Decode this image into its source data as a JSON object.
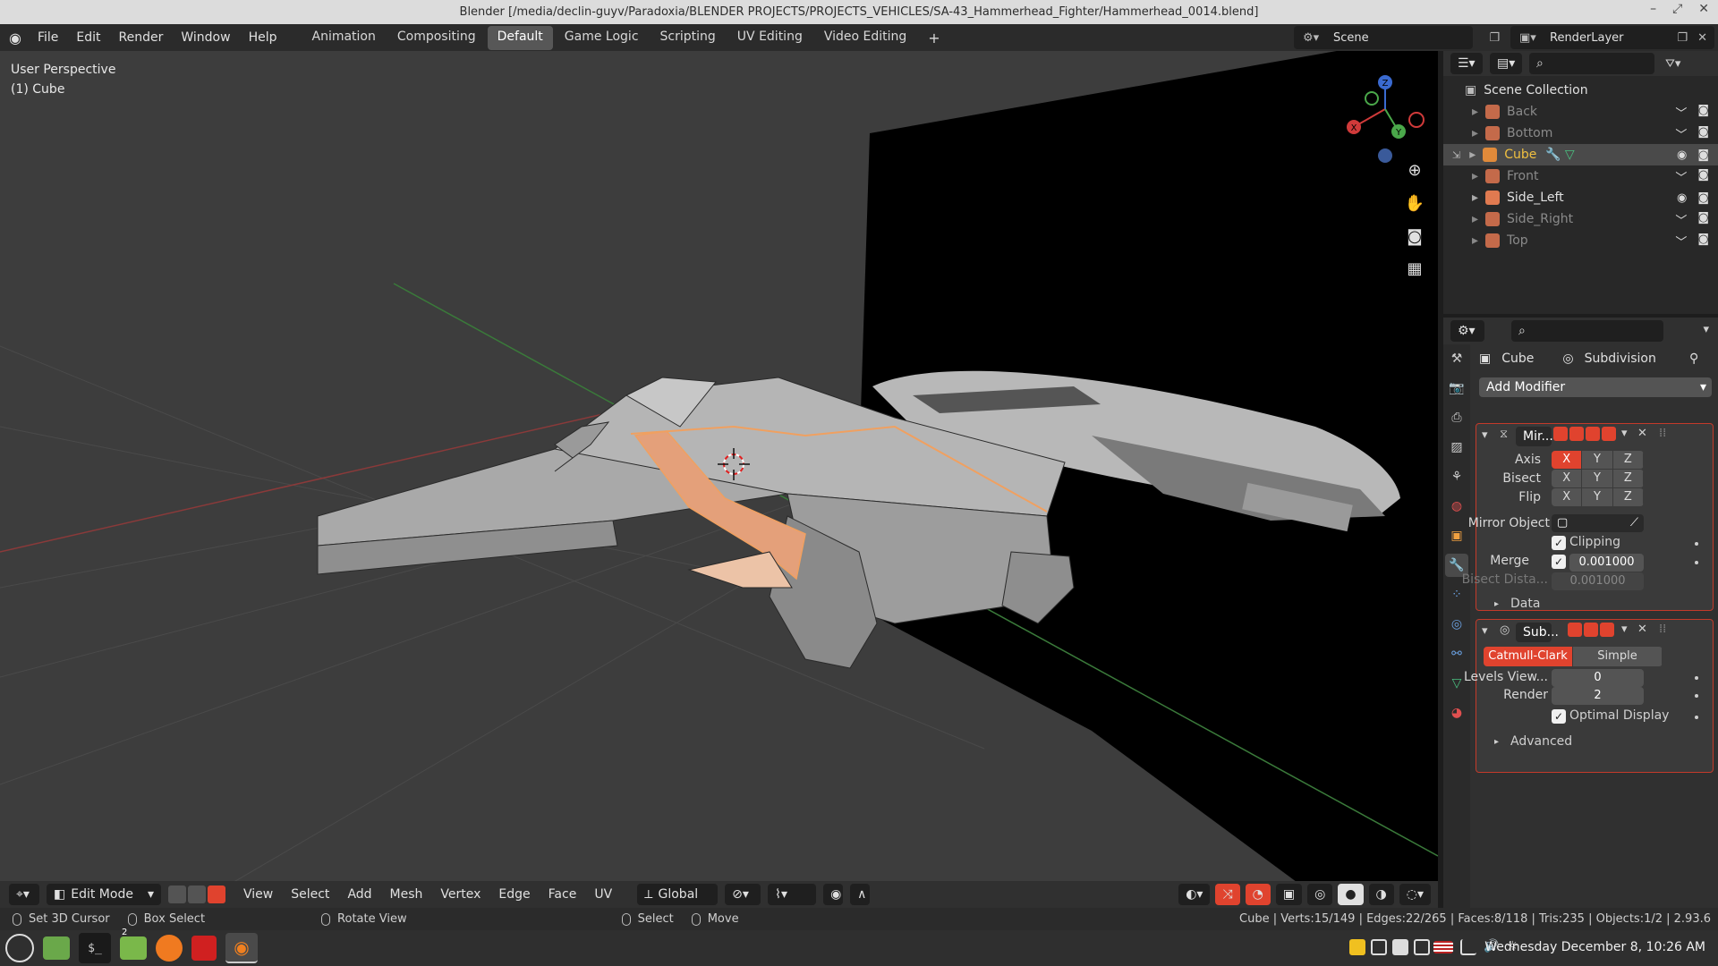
{
  "window": {
    "title": "Blender [/media/declin-guyv/Paradoxia/BLENDER PROJECTS/PROJECTS_VEHICLES/SA-43_Hammerhead_Fighter/Hammerhead_0014.blend]"
  },
  "menus": [
    "File",
    "Edit",
    "Render",
    "Window",
    "Help"
  ],
  "workspaces": [
    {
      "label": "Animation",
      "active": false
    },
    {
      "label": "Compositing",
      "active": false
    },
    {
      "label": "Default",
      "active": true
    },
    {
      "label": "Game Logic",
      "active": false
    },
    {
      "label": "Scripting",
      "active": false
    },
    {
      "label": "UV Editing",
      "active": false
    },
    {
      "label": "Video Editing",
      "active": false
    }
  ],
  "scene": {
    "name": "Scene",
    "render_layer": "RenderLayer"
  },
  "viewport": {
    "perspective": "User Perspective",
    "active_object": "(1) Cube",
    "gizmo_axes": [
      "X",
      "Y",
      "Z"
    ]
  },
  "viewport_header": {
    "mode": "Edit Mode",
    "menus": [
      "View",
      "Select",
      "Add",
      "Mesh",
      "Vertex",
      "Edge",
      "Face",
      "UV"
    ],
    "orientation": "Global"
  },
  "outliner": {
    "root": "Scene Collection",
    "items": [
      {
        "name": "Back",
        "selected": false,
        "visible": false
      },
      {
        "name": "Bottom",
        "selected": false,
        "visible": false
      },
      {
        "name": "Cube",
        "selected": true,
        "visible": true
      },
      {
        "name": "Front",
        "selected": false,
        "visible": false
      },
      {
        "name": "Side_Left",
        "selected": false,
        "visible": true
      },
      {
        "name": "Side_Right",
        "selected": false,
        "visible": false
      },
      {
        "name": "Top",
        "selected": false,
        "visible": false
      }
    ]
  },
  "properties": {
    "object": "Cube",
    "modifier_context": "Subdivision",
    "add_modifier": "Add Modifier",
    "mirror": {
      "name": "Mir...",
      "axis_label": "Axis",
      "bisect_label": "Bisect",
      "flip_label": "Flip",
      "axes": [
        "X",
        "Y",
        "Z"
      ],
      "mirror_object_label": "Mirror Object",
      "clipping_label": "Clipping",
      "merge_label": "Merge",
      "merge_value": "0.001000",
      "bisect_distance_label": "Bisect Dista...",
      "bisect_distance_value": "0.001000",
      "data_label": "Data"
    },
    "subdivision": {
      "name": "Sub...",
      "catmull": "Catmull-Clark",
      "simple": "Simple",
      "levels_label": "Levels View...",
      "levels_value": "0",
      "render_label": "Render",
      "render_value": "2",
      "optimal_label": "Optimal Display",
      "advanced_label": "Advanced"
    }
  },
  "status": {
    "set_cursor": "Set 3D Cursor",
    "box_select": "Box Select",
    "rotate_view": "Rotate View",
    "select": "Select",
    "move": "Move",
    "stats": "Cube | Verts:15/149 | Edges:22/265 | Faces:8/118 | Tris:235 | Objects:1/2 | 2.93.6"
  },
  "taskbar": {
    "clock": "Wednesday December  8, 10:26 AM",
    "badge": "2"
  },
  "colors": {
    "accent": "#e0432e",
    "selection": "#f0a060",
    "viewport_bg": "#3d3d3d"
  }
}
